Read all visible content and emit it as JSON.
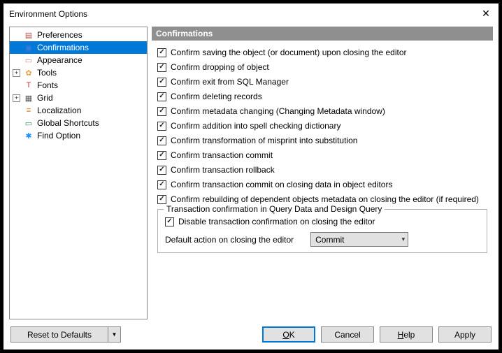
{
  "window": {
    "title": "Environment Options"
  },
  "tree": {
    "items": [
      {
        "label": "Preferences",
        "icon": "pref-icon"
      },
      {
        "label": "Confirmations",
        "icon": "conf-icon"
      },
      {
        "label": "Appearance",
        "icon": "app-icon"
      },
      {
        "label": "Tools",
        "icon": "tools-icon"
      },
      {
        "label": "Fonts",
        "icon": "font-icon"
      },
      {
        "label": "Grid",
        "icon": "grid-icon"
      },
      {
        "label": "Localization",
        "icon": "loc-icon"
      },
      {
        "label": "Global Shortcuts",
        "icon": "keys-icon"
      },
      {
        "label": "Find Option",
        "icon": "find-icon"
      }
    ]
  },
  "section": {
    "title": "Confirmations"
  },
  "checks": [
    "Confirm saving the object (or document) upon closing the editor",
    "Confirm dropping of object",
    "Confirm exit from SQL Manager",
    "Confirm deleting records",
    "Confirm metadata changing (Changing Metadata window)",
    "Confirm addition into spell checking dictionary",
    "Confirm transformation of misprint into substitution",
    "Confirm transaction commit",
    "Confirm transaction rollback",
    "Confirm transaction commit on closing data in object editors",
    "Confirm rebuilding of dependent objects metadata on closing the editor (if required)"
  ],
  "group": {
    "title": "Transaction confirmation in Query Data and Design Query",
    "disable_label": "Disable transaction confirmation on closing the editor",
    "default_action_label": "Default action on closing the editor",
    "default_action_value": "Commit"
  },
  "footer": {
    "reset": "Reset to Defaults",
    "ok": "OK",
    "cancel": "Cancel",
    "help": "Help",
    "apply": "Apply"
  }
}
